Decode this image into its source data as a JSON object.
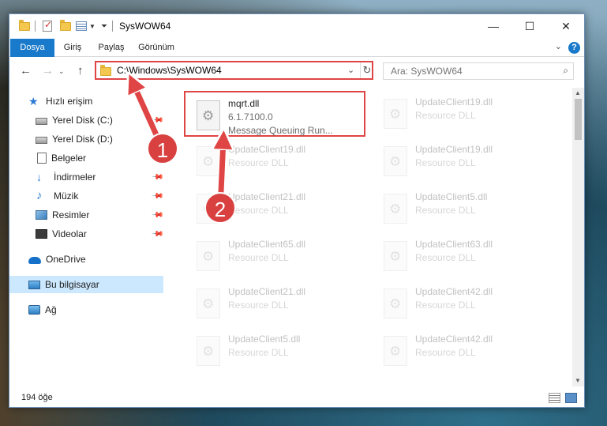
{
  "window": {
    "title": "SysWOW64",
    "controls": {
      "minimize": "—",
      "maximize": "☐",
      "close": "✕"
    }
  },
  "ribbon": {
    "tabs": [
      "Dosya",
      "Giriş",
      "Paylaş",
      "Görünüm"
    ],
    "active_tab": "Dosya",
    "accent_color": "#1979ca",
    "help": "?"
  },
  "address_bar": {
    "path": "C:\\Windows\\SysWOW64",
    "highlight_color": "#e04545"
  },
  "search": {
    "placeholder": "Ara: SysWOW64"
  },
  "nav_pane": {
    "items": [
      {
        "label": "Hızlı erişim",
        "icon": "star-icon"
      },
      {
        "label": "Yerel Disk (C:)",
        "icon": "drive-icon",
        "pinned": true
      },
      {
        "label": "Yerel Disk (D:)",
        "icon": "drive-icon",
        "pinned": true
      },
      {
        "label": "Belgeler",
        "icon": "documents-icon",
        "pinned": true
      },
      {
        "label": "İndirmeler",
        "icon": "downloads-icon",
        "pinned": true
      },
      {
        "label": "Müzik",
        "icon": "music-icon",
        "pinned": true
      },
      {
        "label": "Resimler",
        "icon": "pictures-icon",
        "pinned": true
      },
      {
        "label": "Videolar",
        "icon": "videos-icon",
        "pinned": true
      },
      {
        "label": "OneDrive",
        "icon": "onedrive-icon"
      },
      {
        "label": "Bu bilgisayar",
        "icon": "this-pc-icon",
        "selected": true
      },
      {
        "label": "Ağ",
        "icon": "network-icon"
      }
    ]
  },
  "files": [
    {
      "name": "mqrt.dll",
      "version": "6.1.7100.0",
      "description": "Message Queuing Run...",
      "highlighted": true
    },
    {
      "name": "UpdateClient19.dll",
      "description": "Resource DLL"
    },
    {
      "name": "UpdateClient19.dll",
      "description": "Resource DLL"
    },
    {
      "name": "UpdateClient19.dll",
      "description": "Resource DLL"
    },
    {
      "name": "UpdateClient21.dll",
      "description": "Resource DLL"
    },
    {
      "name": "UpdateClient5.dll",
      "description": "Resource DLL"
    },
    {
      "name": "UpdateClient65.dll",
      "description": "Resource DLL"
    },
    {
      "name": "UpdateClient63.dll",
      "description": "Resource DLL"
    },
    {
      "name": "UpdateClient21.dll",
      "description": "Resource DLL"
    },
    {
      "name": "UpdateClient42.dll",
      "description": "Resource DLL"
    },
    {
      "name": "UpdateClient5.dll",
      "description": "Resource DLL"
    },
    {
      "name": "UpdateClient42.dll",
      "description": "Resource DLL"
    }
  ],
  "status_bar": {
    "item_count": "194 öğe"
  },
  "annotations": {
    "step1": "1",
    "step2": "2",
    "color": "#d94040"
  }
}
